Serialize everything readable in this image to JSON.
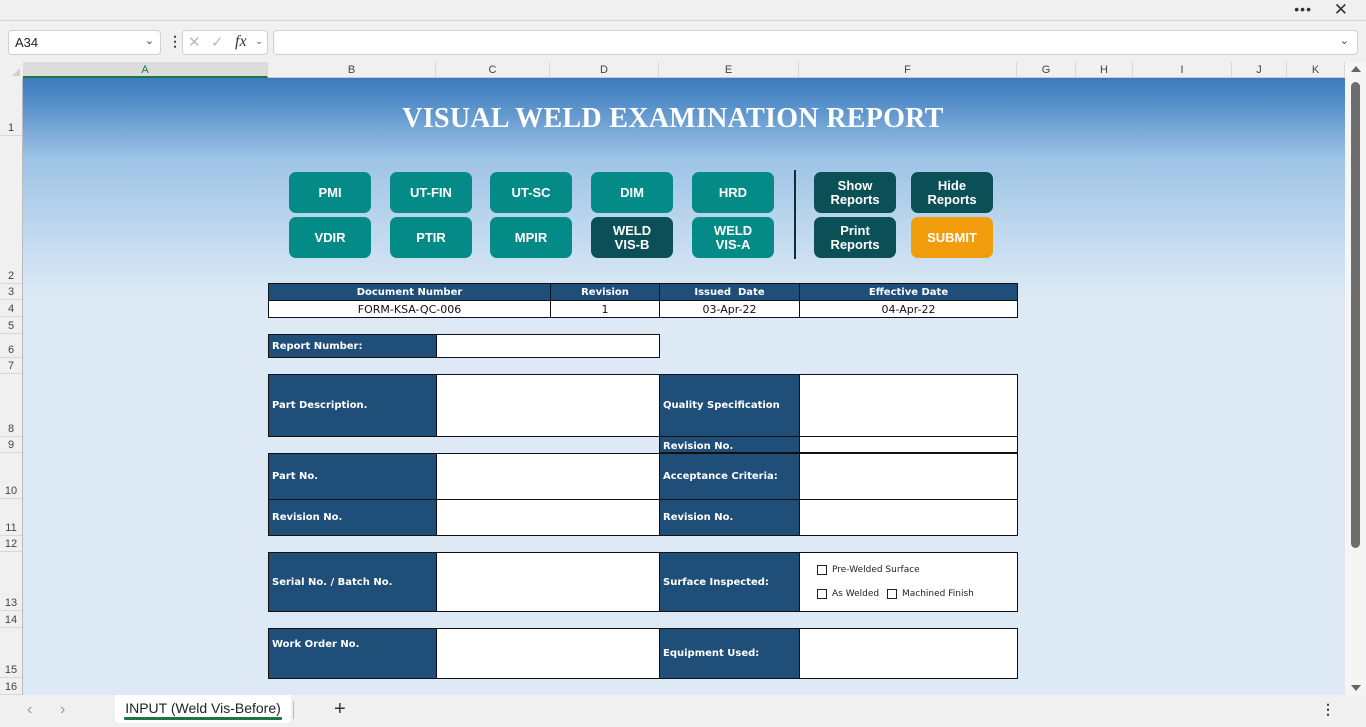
{
  "window": {
    "more_icon": "more-horizontal-icon",
    "close_icon": "close-icon"
  },
  "formula_bar": {
    "name_box": "A34",
    "formula": "",
    "fx_label": "fx"
  },
  "columns": [
    "A",
    "B",
    "C",
    "D",
    "E",
    "F",
    "G",
    "H",
    "I",
    "J",
    "K"
  ],
  "selected_column": "A",
  "rows": [
    "1",
    "2",
    "3",
    "4",
    "5",
    "6",
    "7",
    "8",
    "9",
    "10",
    "11",
    "12",
    "13",
    "14",
    "15",
    "16"
  ],
  "sheet": {
    "title": "VISUAL WELD EXAMINATION REPORT",
    "buttons": {
      "pmi": "PMI",
      "ut_fin": "UT-FIN",
      "ut_sc": "UT-SC",
      "dim": "DIM",
      "hrd": "HRD",
      "vdir": "VDIR",
      "ptir": "PTIR",
      "mpir": "MPIR",
      "weld_vis_b": "WELD\nVIS-B",
      "weld_vis_a": "WELD\nVIS-A",
      "show_reports": "Show\nReports",
      "hide_reports": "Hide\nReports",
      "print_reports": "Print\nReports",
      "submit": "SUBMIT"
    },
    "doc_table": {
      "headers": [
        "Document Number",
        "Revision",
        "Issued  Date",
        "Effective Date"
      ],
      "values": [
        "FORM-KSA-QC-006",
        "1",
        "03-Apr-22",
        "04-Apr-22"
      ]
    },
    "form": {
      "report_number": "Report Number:",
      "part_description": "Part Description.",
      "quality_specification": "Quality Specification",
      "revision_no_spec": "Revision No.",
      "part_no": "Part No.",
      "acceptance_criteria": "Acceptance Criteria:",
      "revision_no_part": "Revision No.",
      "revision_no_criteria": "Revision No.",
      "serial_batch": "Serial No. / Batch No.",
      "surface_inspected": "Surface Inspected:",
      "work_order": "Work Order No.",
      "equipment_used": "Equipment Used:"
    },
    "surface_options": [
      {
        "label": "Pre-Welded Surface",
        "checked": false
      },
      {
        "label": "As Welded",
        "checked": false
      },
      {
        "label": "Machined Finish",
        "checked": false
      }
    ]
  },
  "tabs": {
    "active": "INPUT (Weld Vis-Before)",
    "add": "+"
  },
  "colors": {
    "header_navy": "#1f4e79",
    "button_teal": "#058b87",
    "button_dark": "#0b4f57",
    "button_submit": "#f29e0c",
    "excel_green": "#217346"
  }
}
